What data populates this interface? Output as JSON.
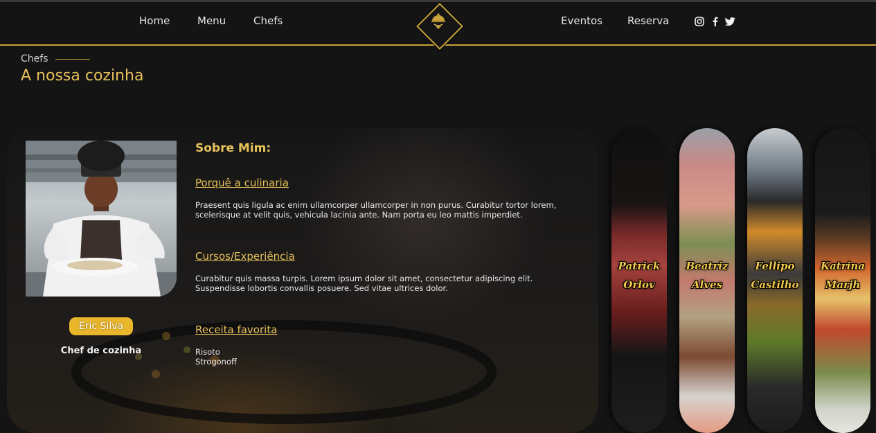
{
  "nav": {
    "left_links": [
      "Home",
      "Menu",
      "Chefs"
    ],
    "right_links": [
      "Eventos",
      "Reserva"
    ],
    "social_icons": [
      "instagram-icon",
      "facebook-icon",
      "twitter-icon"
    ]
  },
  "section": {
    "eyebrow": "Chefs",
    "title": "A nossa cozinha"
  },
  "featured_chef": {
    "name": "Eric Silva",
    "role": "Chef de cozinha",
    "about_title": "Sobre Mim:",
    "sections": [
      {
        "heading": "Porquê a culinaria",
        "lines": [
          "Praesent quis ligula ac enim ullamcorper ullamcorper in non purus. Curabitur tortor lorem,",
          "scelerisque at velit quis, vehicula lacinia ante. Nam porta eu leo mattis imperdiet."
        ]
      },
      {
        "heading": "Cursos/Experiência",
        "lines": [
          "Curabitur quis massa turpis. Lorem ipsum dolor sit amet, consectetur adipiscing elit.",
          "Suspendisse lobortis convallis posuere. Sed vitae ultrices dolor."
        ]
      },
      {
        "heading": "Receita favorita",
        "lines": [
          "Risoto",
          "Strogonoff"
        ]
      }
    ]
  },
  "other_chefs": [
    {
      "first": "Patrick",
      "last": "Orlov"
    },
    {
      "first": "Beatriz",
      "last": "Alves"
    },
    {
      "first": "Fellipo",
      "last": "Castilho"
    },
    {
      "first": "Katrina",
      "last": "Marjh"
    }
  ],
  "colors": {
    "accent": "#c9a23a",
    "title_gold": "#e7c15a",
    "badge": "#e9b52a",
    "background": "#141414"
  }
}
